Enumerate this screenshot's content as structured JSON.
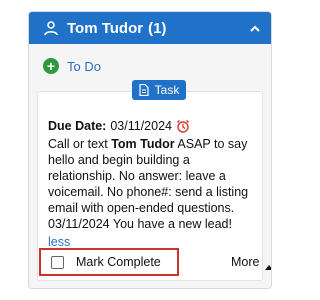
{
  "header": {
    "name": "Tom Tudor",
    "count": "(1)",
    "icons": {
      "person": "person-icon",
      "collapse": "chevron-up-icon"
    },
    "colors": {
      "bg": "#1f72c7",
      "text": "#ffffff"
    }
  },
  "todo": {
    "label": "To Do",
    "icon": "plus-circle-icon",
    "icon_color": "#2e9a3d"
  },
  "task": {
    "badge_label": "Task",
    "badge_icon": "document-icon",
    "due_label": "Due Date:",
    "due_value": "03/11/2024",
    "alarm_icon": "alarm-clock-icon",
    "desc_prefix": "Call or text ",
    "desc_name": "Tom Tudor",
    "desc_suffix": " ASAP to say hello and begin building a relationship. No answer: leave a voicemail. No phone#: send a listing email with open-ended questions. 03/11/2024 You have a new lead!",
    "less_link": "less",
    "mark_complete_label": "Mark Complete",
    "more_label": "More",
    "accent_link": "#2b6fbf",
    "highlight_border": "#c8352b"
  }
}
